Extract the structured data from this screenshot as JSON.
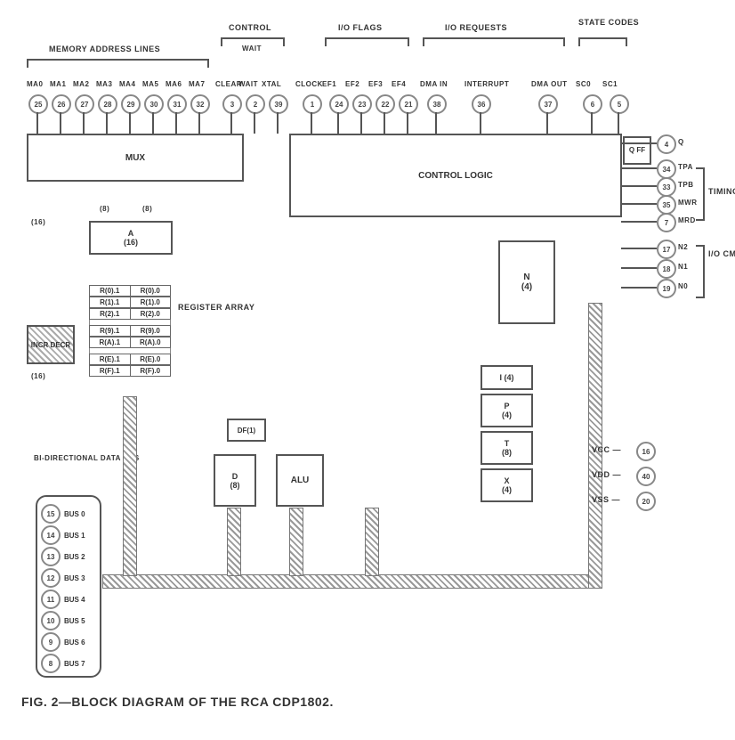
{
  "caption": "FIG. 2—BLOCK DIAGRAM OF THE RCA CDP1802.",
  "groups": {
    "memaddr": "MEMORY ADDRESS LINES",
    "control": "CONTROL",
    "wait": "WAIT",
    "ioflags": "I/O FLAGS",
    "ioreq": "I/O REQUESTS",
    "state": "STATE CODES",
    "timing": "TIMING",
    "iocmds": "I/O CMDS",
    "databus": "BI-DIRECTIONAL DATA BUS",
    "regarray": "REGISTER ARRAY"
  },
  "blocks": {
    "mux": "MUX",
    "ctrl": "CONTROL LOGIC",
    "qff": "Q FF",
    "a": "A\n(16)",
    "incr": "INCR DECR",
    "n": "N\n(4)",
    "i": "I (4)",
    "p": "P\n(4)",
    "t": "T\n(8)",
    "x": "X\n(4)",
    "d": "D\n(8)",
    "df": "DF(1)",
    "alu": "ALU"
  },
  "ma": [
    {
      "name": "MA0",
      "pin": "25"
    },
    {
      "name": "MA1",
      "pin": "26"
    },
    {
      "name": "MA2",
      "pin": "27"
    },
    {
      "name": "MA3",
      "pin": "28"
    },
    {
      "name": "MA4",
      "pin": "29"
    },
    {
      "name": "MA5",
      "pin": "30"
    },
    {
      "name": "MA6",
      "pin": "31"
    },
    {
      "name": "MA7",
      "pin": "32"
    }
  ],
  "top_signals": [
    {
      "name": "CLEAR",
      "pin": "3"
    },
    {
      "name": "WAIT",
      "pin": "2"
    },
    {
      "name": "XTAL",
      "pin": "39"
    },
    {
      "name": "CLOCK",
      "pin": "1"
    },
    {
      "name": "EF1",
      "pin": "24"
    },
    {
      "name": "EF2",
      "pin": "23"
    },
    {
      "name": "EF3",
      "pin": "22"
    },
    {
      "name": "EF4",
      "pin": "21"
    },
    {
      "name": "DMA IN",
      "pin": "38"
    },
    {
      "name": "INTERRUPT",
      "pin": "36"
    },
    {
      "name": "DMA OUT",
      "pin": "37"
    },
    {
      "name": "SC0",
      "pin": "6"
    },
    {
      "name": "SC1",
      "pin": "5"
    }
  ],
  "right_signals": [
    {
      "name": "Q",
      "pin": "4"
    },
    {
      "name": "TPA",
      "pin": "34"
    },
    {
      "name": "TPB",
      "pin": "33"
    },
    {
      "name": "MWR",
      "pin": "35"
    },
    {
      "name": "MRD",
      "pin": "7"
    },
    {
      "name": "N2",
      "pin": "17"
    },
    {
      "name": "N1",
      "pin": "18"
    },
    {
      "name": "N0",
      "pin": "19"
    }
  ],
  "power": [
    {
      "name": "VCC",
      "pin": "16"
    },
    {
      "name": "VDD",
      "pin": "40"
    },
    {
      "name": "VSS",
      "pin": "20"
    }
  ],
  "bus": [
    {
      "name": "BUS 0",
      "pin": "15"
    },
    {
      "name": "BUS 1",
      "pin": "14"
    },
    {
      "name": "BUS 2",
      "pin": "13"
    },
    {
      "name": "BUS 3",
      "pin": "12"
    },
    {
      "name": "BUS 4",
      "pin": "11"
    },
    {
      "name": "BUS 5",
      "pin": "10"
    },
    {
      "name": "BUS 6",
      "pin": "9"
    },
    {
      "name": "BUS 7",
      "pin": "8"
    }
  ],
  "regs": [
    [
      "R(0).1",
      "R(0).0"
    ],
    [
      "R(1).1",
      "R(1).0"
    ],
    [
      "R(2).1",
      "R(2).0"
    ],
    [
      "R(9).1",
      "R(9).0"
    ],
    [
      "R(A).1",
      "R(A).0"
    ],
    [
      "R(E).1",
      "R(E).0"
    ],
    [
      "R(F).1",
      "R(F).0"
    ]
  ],
  "buswidth": {
    "a8": "(8)",
    "a16": "(16)"
  }
}
